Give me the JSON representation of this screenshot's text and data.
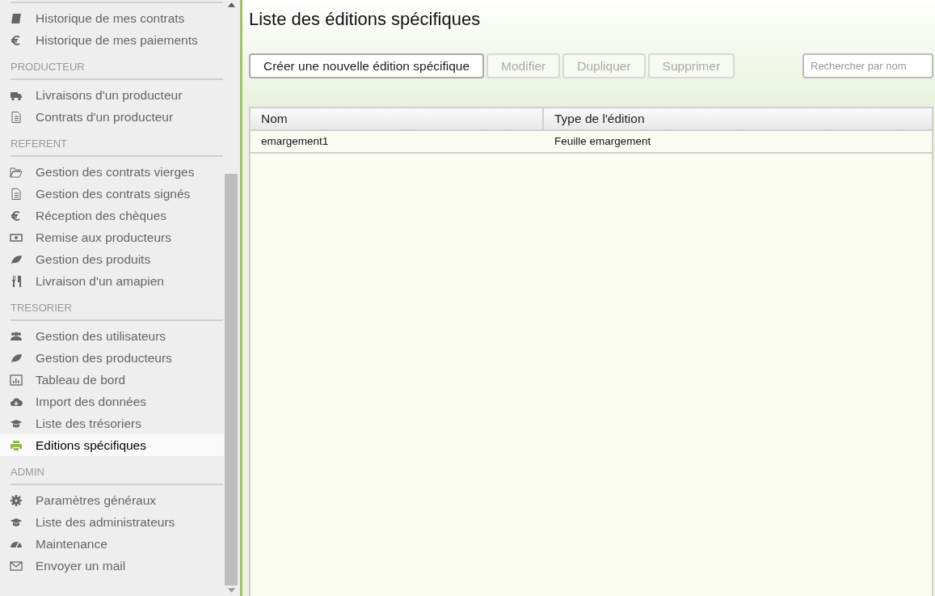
{
  "sidebar": {
    "groups": [
      {
        "items": [
          {
            "kind": "book",
            "label": "Historique de mes contrats",
            "selected": false
          },
          {
            "kind": "euro",
            "label": "Historique de mes paiements",
            "selected": false
          }
        ]
      },
      {
        "header": "PRODUCTEUR",
        "items": [
          {
            "kind": "truck",
            "label": "Livraisons d'un producteur",
            "selected": false
          },
          {
            "kind": "doc",
            "label": "Contrats d'un producteur",
            "selected": false
          }
        ]
      },
      {
        "header": "REFERENT",
        "items": [
          {
            "kind": "folder",
            "label": "Gestion des contrats vierges",
            "selected": false
          },
          {
            "kind": "doc",
            "label": "Gestion des contrats signés",
            "selected": false
          },
          {
            "kind": "euro",
            "label": "Réception des chèques",
            "selected": false
          },
          {
            "kind": "money",
            "label": "Remise aux producteurs",
            "selected": false
          },
          {
            "kind": "leaf",
            "label": "Gestion des produits",
            "selected": false
          },
          {
            "kind": "cutlery",
            "label": "Livraison d'un amapien",
            "selected": false
          }
        ]
      },
      {
        "header": "TRESORIER",
        "items": [
          {
            "kind": "users",
            "label": "Gestion des utilisateurs",
            "selected": false
          },
          {
            "kind": "leaf",
            "label": "Gestion des producteurs",
            "selected": false
          },
          {
            "kind": "chart",
            "label": "Tableau de bord",
            "selected": false
          },
          {
            "kind": "cloud",
            "label": "Import des données",
            "selected": false
          },
          {
            "kind": "cap",
            "label": "Liste des trésoriers",
            "selected": false
          },
          {
            "kind": "printer",
            "label": "Editions spécifiques",
            "selected": true
          }
        ]
      },
      {
        "header": "ADMIN",
        "items": [
          {
            "kind": "gear",
            "label": "Paramètres généraux",
            "selected": false
          },
          {
            "kind": "cap",
            "label": "Liste des administrateurs",
            "selected": false
          },
          {
            "kind": "dashboard",
            "label": "Maintenance",
            "selected": false
          },
          {
            "kind": "mail",
            "label": "Envoyer un mail",
            "selected": false
          }
        ]
      }
    ]
  },
  "page": {
    "title": "Liste des éditions spécifiques"
  },
  "toolbar": {
    "buttons": [
      {
        "label": "Créer une nouvelle édition spécifique",
        "disabled": false
      },
      {
        "label": "Modifier",
        "disabled": true
      },
      {
        "label": "Dupliquer",
        "disabled": true
      },
      {
        "label": "Supprimer",
        "disabled": true
      }
    ],
    "search": {
      "placeholder": "Rechercher par nom"
    }
  },
  "table": {
    "columns": [
      "Nom",
      "Type de l'édition"
    ],
    "rows": [
      [
        "emargement1",
        "Feuille emargement"
      ]
    ]
  }
}
